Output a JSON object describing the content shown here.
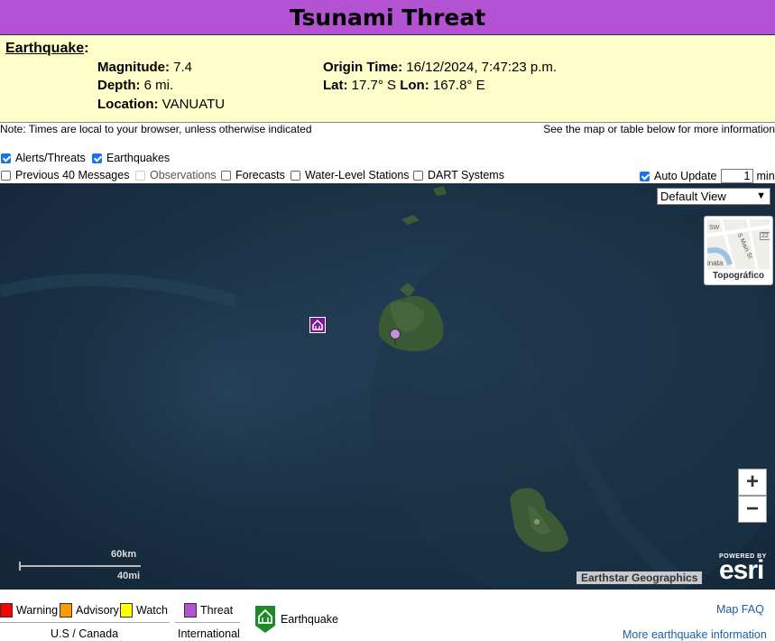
{
  "header": {
    "title": "Tsunami Threat"
  },
  "earthquake": {
    "heading": "Earthquake",
    "magnitude_label": "Magnitude:",
    "magnitude": "7.4",
    "depth_label": "Depth:",
    "depth": "6 mi.",
    "location_label": "Location:",
    "location": "VANUATU",
    "origin_label": "Origin Time:",
    "origin_time": "16/12/2024, 7:47:23 p.m.",
    "lat_label": "Lat:",
    "lat": "17.7° S",
    "lon_label": "Lon:",
    "lon": "167.8° E"
  },
  "notes": {
    "left": "Note: Times are local to your browser, unless otherwise indicated",
    "right": "See the map or table below for more information"
  },
  "filters": {
    "alerts": {
      "label": "Alerts/Threats",
      "checked": true
    },
    "earthquakes": {
      "label": "Earthquakes",
      "checked": true
    },
    "previous": {
      "label": "Previous 40 Messages",
      "checked": false
    },
    "observations": {
      "label": "Observations",
      "checked": false,
      "disabled": true
    },
    "forecasts": {
      "label": "Forecasts",
      "checked": false
    },
    "water_level": {
      "label": "Water-Level Stations",
      "checked": false
    },
    "dart": {
      "label": "DART Systems",
      "checked": false
    },
    "auto_update": {
      "label": "Auto Update",
      "checked": true,
      "value": "1",
      "unit": "min"
    }
  },
  "map": {
    "view_select": "Default View",
    "basemap_label": "Topográfico",
    "zoom_in": "+",
    "zoom_out": "−",
    "scale_km": "60km",
    "scale_mi": "40mi",
    "attribution": "Earthstar Geographics",
    "powered_by": "POWERED BY",
    "esri": "esri",
    "thumb_text_1": "S Main St",
    "thumb_text_2": "inata",
    "thumb_text_3": "SW",
    "thumb_text_4": "22"
  },
  "legend": {
    "warning": "Warning",
    "advisory": "Advisory",
    "watch": "Watch",
    "threat": "Threat",
    "us_canada": "U.S / Canada",
    "international": "International",
    "earthquake": "Earthquake",
    "map_faq": "Map FAQ",
    "more_info": "More earthquake information",
    "colors": {
      "warning": "#ff0000",
      "advisory": "#ff9900",
      "watch": "#ffff00",
      "threat": "#b452d4",
      "earthquake_icon": "#1e8a2a"
    }
  }
}
